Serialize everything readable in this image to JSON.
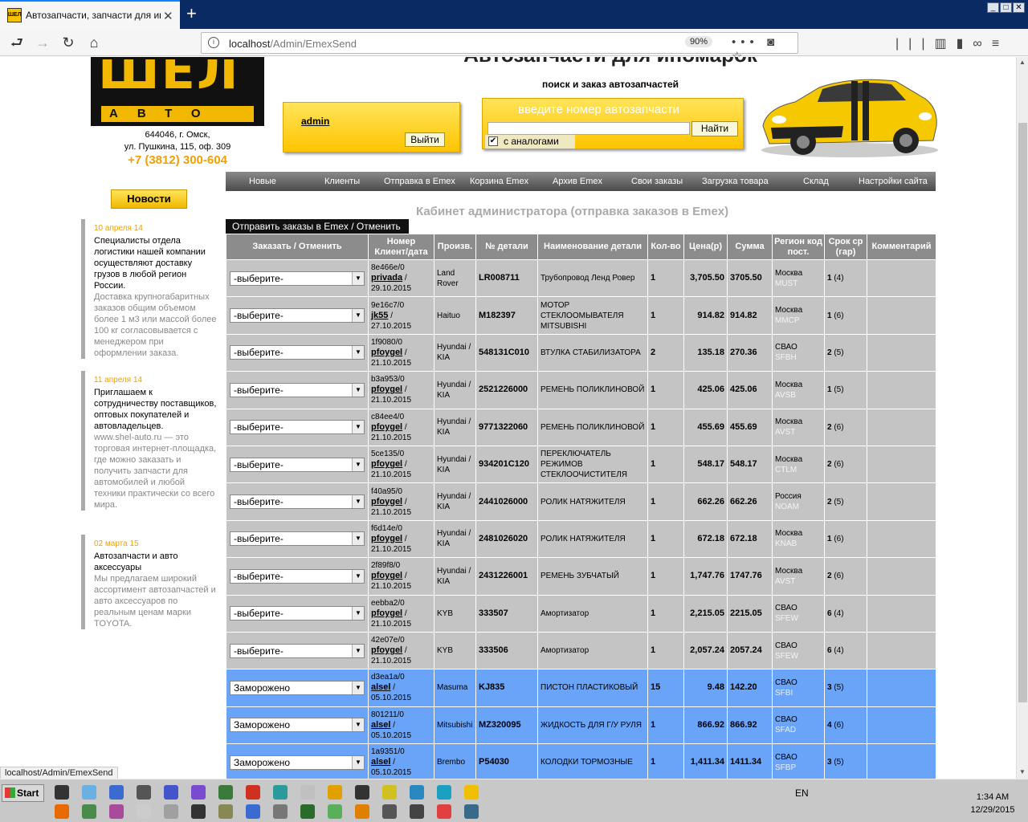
{
  "browser": {
    "tab_title": "Автозапчасти, запчасти для иномарок",
    "favicon_text": "ШЕЛ",
    "url_host": "localhost",
    "url_path": "/Admin/EmexSend",
    "zoom": "90%",
    "status_url": "localhost/Admin/EmexSend"
  },
  "header": {
    "logo_big": "ШЕЛ",
    "logo_sub": "АВТО",
    "address_line1": "644046, г. Омск,",
    "address_line2": "ул. Пушкина, 115, оф. 309",
    "phone": "+7 (3812) 300-604",
    "site_title": "Автозапчасти для иномарок",
    "subtitle": "поиск и заказ автозапчастей",
    "user_link": "admin",
    "logout_label": "Выйти",
    "search_placeholder": "введите номер автозапчасти",
    "search_button": "Найти",
    "analogs_label": "с аналогами"
  },
  "menu": [
    "Новые",
    "Клиенты",
    "Отправка в Emex",
    "Корзина Emex",
    "Архив Emex",
    "Свои заказы",
    "Загрузка товара",
    "Склад",
    "Настройки сайта"
  ],
  "news_button": "Новости",
  "news": [
    {
      "date": "10 апреля 14",
      "head": "Специалисты отдела логистики нашей компании осуществляют доставку грузов в любой регион России.",
      "body": "Доставка крупногабаритных заказов общим объемом более 1 м3 или массой более 100 кг согласовывается с менеджером при оформлении заказа."
    },
    {
      "date": "11 апреля 14",
      "head": "Приглашаем к сотрудничеству поставщиков, оптовых покупателей и автовладельцев.",
      "body": "www.shel-auto.ru — это торговая интернет-площадка, где можно заказать и получить запчасти для автомобилей и любой техники практически со всего мира."
    },
    {
      "date": "02 марта 15",
      "head": "Автозапчасти и авто аксессуары",
      "body": "Мы предлагаем широкий ассортимент автозапчастей и авто аксессуаров по реальным ценам марки TOYOTA."
    }
  ],
  "cabinet_title": "Кабинет администратора (отправка заказов в Emex)",
  "send_button": "Отправить заказы в Emex / Отменить",
  "table": {
    "headers": [
      "Заказать / Отменить",
      "Номер Клиент/дата",
      "Произв.",
      "№ детали",
      "Наименование детали",
      "Кол-во",
      "Цена(р)",
      "Сумма",
      "Регион код пост.",
      "Срок ср (гар)",
      "Комментарий"
    ],
    "rows": [
      {
        "action": "-выберите-",
        "num": "8e466e/0",
        "client": "privada",
        "date": "29.10.2015",
        "mfr": "Land Rover",
        "part": "LR008711",
        "name": "Трубопровод Ленд Ровер",
        "qty": "1",
        "price": "3,705.50",
        "sum": "3705.50",
        "region": "Москва",
        "code": "MUST",
        "term": "1",
        "guar": "(4)",
        "state": "grey"
      },
      {
        "action": "-выберите-",
        "num": "9e16c7/0",
        "client": "jk55",
        "date": "27.10.2015",
        "mfr": "Haituo",
        "part": "M182397",
        "name": "МОТОР СТЕКЛООМЫВАТЕЛЯ MITSUBISHI",
        "qty": "1",
        "price": "914.82",
        "sum": "914.82",
        "region": "Москва",
        "code": "MMCP",
        "term": "1",
        "guar": "(6)",
        "state": "grey"
      },
      {
        "action": "-выберите-",
        "num": "1f9080/0",
        "client": "pfoygel",
        "date": "21.10.2015",
        "mfr": "Hyundai / KIA",
        "part": "548131C010",
        "name": "ВТУЛКА СТАБИЛИЗАТОРА",
        "qty": "2",
        "price": "135.18",
        "sum": "270.36",
        "region": "СВАО",
        "code": "SFBH",
        "term": "2",
        "guar": "(5)",
        "state": "grey"
      },
      {
        "action": "-выберите-",
        "num": "b3a953/0",
        "client": "pfoygel",
        "date": "21.10.2015",
        "mfr": "Hyundai / KIA",
        "part": "2521226000",
        "name": "РЕМЕНЬ ПОЛИКЛИНОВОЙ",
        "qty": "1",
        "price": "425.06",
        "sum": "425.06",
        "region": "Москва",
        "code": "AVSB",
        "term": "1",
        "guar": "(5)",
        "state": "grey"
      },
      {
        "action": "-выберите-",
        "num": "c84ee4/0",
        "client": "pfoygel",
        "date": "21.10.2015",
        "mfr": "Hyundai / KIA",
        "part": "9771322060",
        "name": "РЕМЕНЬ ПОЛИКЛИНОВОЙ",
        "qty": "1",
        "price": "455.69",
        "sum": "455.69",
        "region": "Москва",
        "code": "AVST",
        "term": "2",
        "guar": "(6)",
        "state": "grey"
      },
      {
        "action": "-выберите-",
        "num": "5ce135/0",
        "client": "pfoygel",
        "date": "21.10.2015",
        "mfr": "Hyundai / KIA",
        "part": "934201C120",
        "name": "ПЕРЕКЛЮЧАТЕЛЬ РЕЖИМОВ СТЕКЛООЧИСТИТЕЛЯ",
        "qty": "1",
        "price": "548.17",
        "sum": "548.17",
        "region": "Москва",
        "code": "CTLM",
        "term": "2",
        "guar": "(6)",
        "state": "grey"
      },
      {
        "action": "-выберите-",
        "num": "f40a95/0",
        "client": "pfoygel",
        "date": "21.10.2015",
        "mfr": "Hyundai / KIA",
        "part": "2441026000",
        "name": "РОЛИК НАТЯЖИТЕЛЯ",
        "qty": "1",
        "price": "662.26",
        "sum": "662.26",
        "region": "Россия",
        "code": "NOAM",
        "term": "2",
        "guar": "(5)",
        "state": "grey"
      },
      {
        "action": "-выберите-",
        "num": "f6d14e/0",
        "client": "pfoygel",
        "date": "21.10.2015",
        "mfr": "Hyundai / KIA",
        "part": "2481026020",
        "name": "РОЛИК НАТЯЖИТЕЛЯ",
        "qty": "1",
        "price": "672.18",
        "sum": "672.18",
        "region": "Москва",
        "code": "KNAB",
        "term": "1",
        "guar": "(6)",
        "state": "grey"
      },
      {
        "action": "-выберите-",
        "num": "2f89f8/0",
        "client": "pfoygel",
        "date": "21.10.2015",
        "mfr": "Hyundai / KIA",
        "part": "2431226001",
        "name": "РЕМЕНЬ ЗУБЧАТЫЙ",
        "qty": "1",
        "price": "1,747.76",
        "sum": "1747.76",
        "region": "Москва",
        "code": "AVST",
        "term": "2",
        "guar": "(6)",
        "state": "grey"
      },
      {
        "action": "-выберите-",
        "num": "eebba2/0",
        "client": "pfoygel",
        "date": "21.10.2015",
        "mfr": "KYB",
        "part": "333507",
        "name": "Амортизатор",
        "qty": "1",
        "price": "2,215.05",
        "sum": "2215.05",
        "region": "СВАО",
        "code": "SFEW",
        "term": "6",
        "guar": "(4)",
        "state": "grey"
      },
      {
        "action": "-выберите-",
        "num": "42e07e/0",
        "client": "pfoygel",
        "date": "21.10.2015",
        "mfr": "KYB",
        "part": "333506",
        "name": "Амортизатор",
        "qty": "1",
        "price": "2,057.24",
        "sum": "2057.24",
        "region": "СВАО",
        "code": "SFEW",
        "term": "6",
        "guar": "(4)",
        "state": "grey"
      },
      {
        "action": "Заморожено",
        "num": "d3ea1a/0",
        "client": "alsel",
        "date": "05.10.2015",
        "mfr": "Masuma",
        "part": "KJ835",
        "name": "ПИСТОН ПЛАСТИКОВЫЙ",
        "qty": "15",
        "price": "9.48",
        "sum": "142.20",
        "region": "СВАО",
        "code": "SFBI",
        "term": "3",
        "guar": "(5)",
        "state": "blue"
      },
      {
        "action": "Заморожено",
        "num": "801211/0",
        "client": "alsel",
        "date": "05.10.2015",
        "mfr": "Mitsubishi",
        "part": "MZ320095",
        "name": "ЖИДКОСТЬ ДЛЯ Г/У РУЛЯ",
        "qty": "1",
        "price": "866.92",
        "sum": "866.92",
        "region": "СВАО",
        "code": "SFAD",
        "term": "4",
        "guar": "(6)",
        "state": "blue"
      },
      {
        "action": "Заморожено",
        "num": "1a9351/0",
        "client": "alsel",
        "date": "05.10.2015",
        "mfr": "Brembo",
        "part": "P54030",
        "name": "КОЛОДКИ ТОРМОЗНЫЕ",
        "qty": "1",
        "price": "1,411.34",
        "sum": "1411.34",
        "region": "СВАО",
        "code": "SFBP",
        "term": "3",
        "guar": "(5)",
        "state": "blue"
      }
    ]
  },
  "taskbar": {
    "start_label": "Start",
    "language": "EN",
    "time": "1:34 AM",
    "date": "12/29/2015"
  }
}
